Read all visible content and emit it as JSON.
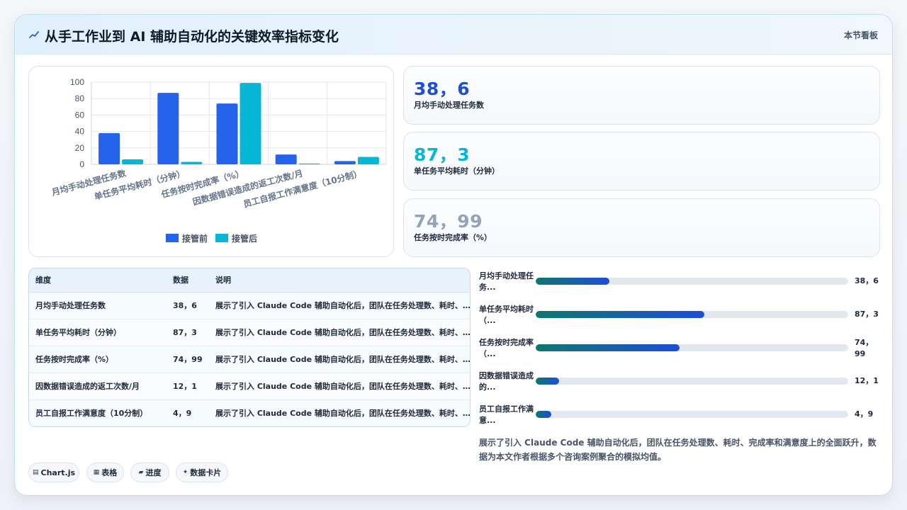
{
  "header": {
    "title": "从手工作业到 AI 辅助自动化的关键效率指标变化",
    "tag": "本节看板"
  },
  "colors": {
    "before": "#2563eb",
    "after": "#06b6d4"
  },
  "chart_data": {
    "type": "bar",
    "categories": [
      "月均手动处理任务数",
      "单任务平均耗时（分钟）",
      "任务按时完成率（%）",
      "因数据错误造成的返工次数/月",
      "员工自报工作满意度（10分制）"
    ],
    "series": [
      {
        "name": "接管前",
        "values": [
          38,
          87,
          74,
          12,
          4
        ]
      },
      {
        "name": "接管后",
        "values": [
          6,
          3,
          99,
          1,
          9
        ]
      }
    ],
    "yticks": [
      "0",
      "20",
      "40",
      "60",
      "80",
      "100"
    ],
    "ylim": [
      0,
      100
    ],
    "grid": true,
    "legend_position": "bottom"
  },
  "stats": [
    {
      "value": "38，6",
      "label": "月均手动处理任务数",
      "color": "#1d4ed8"
    },
    {
      "value": "87，3",
      "label": "单任务平均耗时（分钟）",
      "color": "#06b6d4"
    },
    {
      "value": "74，99",
      "label": "任务按时完成率（%）",
      "color": "#94a3b8"
    }
  ],
  "table": {
    "headers": [
      "维度",
      "数据",
      "说明"
    ],
    "rows": [
      [
        "月均手动处理任务数",
        "38，6",
        "展示了引入 Claude Code 辅助自动化后，团队在任务处理数、耗时、完成率和满意度上的全面跃升，数据为本文作者根据多个咨询案例聚合的模拟均值。"
      ],
      [
        "单任务平均耗时（分钟）",
        "87，3",
        "展示了引入 Claude Code 辅助自动化后，团队在任务处理数、耗时、完成率和满意度上的全面跃升，数据为本文作者根据多个咨询案例聚合的模拟均值。"
      ],
      [
        "任务按时完成率（%）",
        "74，99",
        "展示了引入 Claude Code 辅助自动化后，团队在任务处理数、耗时、完成率和满意度上的全面跃升，数据为本文作者根据多个咨询案例聚合的模拟均值。"
      ],
      [
        "因数据错误造成的返工次数/月",
        "12，1",
        "展示了引入 Claude Code 辅助自动化后，团队在任务处理数、耗时、完成率和满意度上的全面跃升，数据为本文作者根据多个咨询案例聚合的模拟均值。"
      ],
      [
        "员工自报工作满意度（10分制）",
        "4，9",
        "展示了引入 Claude Code 辅助自动化后，团队在任务处理数、耗时、完成率和满意度上的全面跃升，数据为本文作者根据多个咨询案例聚合的模拟均值。"
      ]
    ]
  },
  "progress": [
    {
      "label": "月均手动处理任务...",
      "value": "38，6",
      "fraction": 0.235
    },
    {
      "label": "单任务平均耗时（...",
      "value": "87，3",
      "fraction": 0.54
    },
    {
      "label": "任务按时完成率（...",
      "value": "74，99",
      "fraction": 0.46
    },
    {
      "label": "因数据错误造成的...",
      "value": "12，1",
      "fraction": 0.075
    },
    {
      "label": "员工自报工作满意...",
      "value": "4，9",
      "fraction": 0.05
    }
  ],
  "summary": "展示了引入 Claude Code 辅助自动化后，团队在任务处理数、耗时、完成率和满意度上的全面跃升，数据为本文作者根据多个咨询案例聚合的模拟均值。",
  "pills": [
    {
      "icon": "chart-icon",
      "glyph": "▤",
      "label": "Chart.js"
    },
    {
      "icon": "table-icon",
      "glyph": "▦",
      "label": "表格"
    },
    {
      "icon": "progress-icon",
      "glyph": "▰",
      "label": "进度"
    },
    {
      "icon": "spark-icon",
      "glyph": "✦",
      "label": "数据卡片"
    }
  ]
}
